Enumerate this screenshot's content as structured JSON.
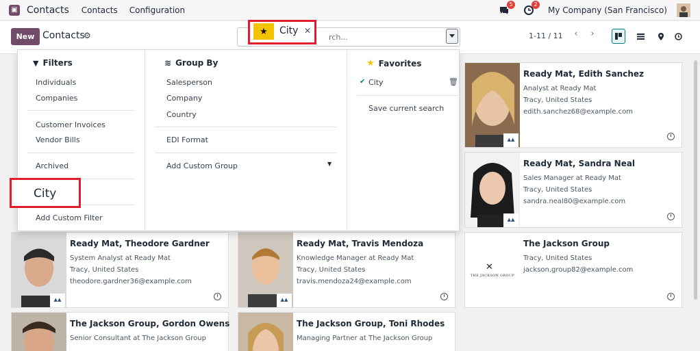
{
  "navbar": {
    "app_name": "Contacts",
    "menu": [
      "Contacts",
      "Configuration"
    ],
    "messages_badge": "5",
    "activities_badge": "2",
    "company": "My Company (San Francisco)"
  },
  "control_panel": {
    "new_label": "New",
    "breadcrumb": "Contacts",
    "search_placeholder": "Search...",
    "search_placeholder_visible": "rch...",
    "facet_label": "City",
    "pager": "1-11 / 11"
  },
  "dropdown": {
    "filters": {
      "title": "Filters",
      "items": [
        "Individuals",
        "Companies",
        "Customer Invoices",
        "Vendor Bills",
        "Archived",
        "City",
        "Add Custom Filter"
      ]
    },
    "group_by": {
      "title": "Group By",
      "items": [
        "Salesperson",
        "Company",
        "Country",
        "EDI Format",
        "Add Custom Group"
      ]
    },
    "favorites": {
      "title": "Favorites",
      "items": [
        "City",
        "Save current search"
      ]
    }
  },
  "cards": [
    {
      "name": "Ready Mat, Edith Sanchez",
      "lines": [
        "Analyst at Ready Mat",
        "Tracy, United States",
        "edith.sanchez68@example.com"
      ]
    },
    {
      "name": "Ready Mat, Sandra Neal",
      "lines": [
        "Sales Manager at Ready Mat",
        "Tracy, United States",
        "sandra.neal80@example.com"
      ]
    },
    {
      "name": "Ready Mat, Theodore Gardner",
      "lines": [
        "System Analyst at Ready Mat",
        "Tracy, United States",
        "theodore.gardner36@example.com"
      ]
    },
    {
      "name": "Ready Mat, Travis Mendoza",
      "lines": [
        "Knowledge Manager at Ready Mat",
        "Tracy, United States",
        "travis.mendoza24@example.com"
      ]
    },
    {
      "name": "The Jackson Group",
      "lines": [
        "Tracy, United States",
        "jackson.group82@example.com"
      ],
      "logo_text": "The Jackson Group"
    },
    {
      "name": "The Jackson Group, Gordon Owens",
      "lines": [
        "Senior Consultant at The Jackson Group"
      ]
    },
    {
      "name": "The Jackson Group, Toni Rhodes",
      "lines": [
        "Managing Partner at The Jackson Group"
      ]
    }
  ],
  "colors": {
    "brand": "#714b67",
    "highlight": "#e11d2b",
    "star": "#f4c300",
    "active_view": "#017e84"
  }
}
